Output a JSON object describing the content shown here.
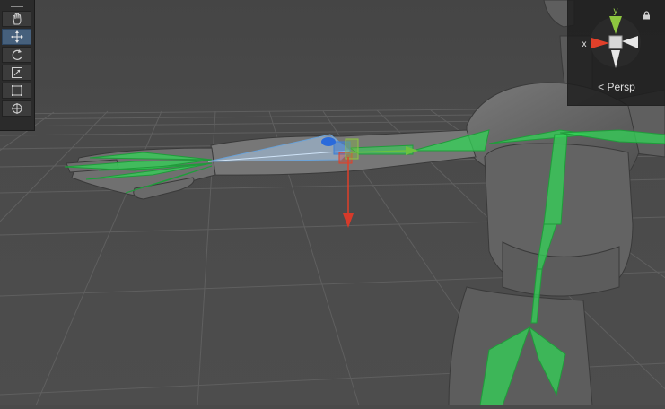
{
  "toolbar": {
    "tools": [
      {
        "name": "hand",
        "active": false
      },
      {
        "name": "move",
        "active": true
      },
      {
        "name": "rotate",
        "active": false
      },
      {
        "name": "scale",
        "active": false
      },
      {
        "name": "rect",
        "active": false
      },
      {
        "name": "transform",
        "active": false
      }
    ]
  },
  "gizmo": {
    "axis_y": "y",
    "axis_x": "x",
    "projection": "Persp",
    "colors": {
      "x": "#e0402a",
      "y": "#8dc63f",
      "z": "#3f7fd6",
      "neutral": "#e8e8e8"
    }
  },
  "scene": {
    "background": "#4a4a4a",
    "grid_color": "#5a5a5a",
    "model_color": "#6b6b6b",
    "bone_color": "#33d457"
  }
}
